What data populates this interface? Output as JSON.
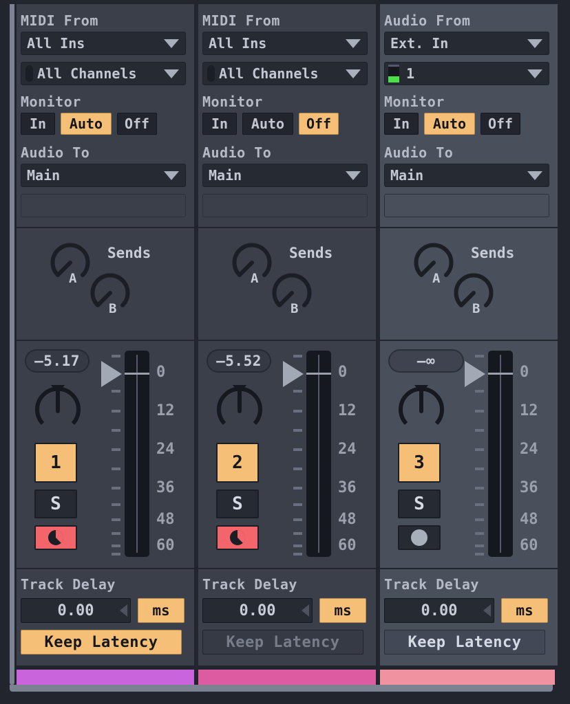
{
  "app": "Ableton Live Mixer Track I/O Panel",
  "channels": [
    {
      "type": "midi",
      "input_label": "MIDI From",
      "input_source": "All Ins",
      "input_channel": "All Channels",
      "input_channel_icon": "midi-activity-indicator",
      "monitor_label": "Monitor",
      "monitor_options": [
        "In",
        "Auto",
        "Off"
      ],
      "monitor_selected": "Auto",
      "output_label": "Audio To",
      "output_target": "Main",
      "output_subtarget": "",
      "sends_label": "Sends",
      "sends": [
        {
          "name": "A",
          "value_deg": -150
        },
        {
          "name": "B",
          "value_deg": -150
        }
      ],
      "volume_display": "–5.17",
      "pan_value_deg": 0,
      "track_number": "1",
      "solo_label": "S",
      "arm_state": "armed",
      "arm_icon": "record-arm-icon",
      "meter_scale": [
        "0",
        "12",
        "24",
        "36",
        "48",
        "60"
      ],
      "fader_position_db": "0",
      "delay_label": "Track Delay",
      "delay_value": "0.00",
      "delay_unit": "ms",
      "keep_latency_label": "Keep Latency",
      "keep_latency_state": "on",
      "track_color": "#c964dd"
    },
    {
      "type": "midi",
      "input_label": "MIDI From",
      "input_source": "All Ins",
      "input_channel": "All Channels",
      "input_channel_icon": "midi-activity-indicator",
      "monitor_label": "Monitor",
      "monitor_options": [
        "In",
        "Auto",
        "Off"
      ],
      "monitor_selected": "Off",
      "output_label": "Audio To",
      "output_target": "Main",
      "output_subtarget": "",
      "sends_label": "Sends",
      "sends": [
        {
          "name": "A",
          "value_deg": -150
        },
        {
          "name": "B",
          "value_deg": -150
        }
      ],
      "volume_display": "–5.52",
      "pan_value_deg": 0,
      "track_number": "2",
      "solo_label": "S",
      "arm_state": "armed",
      "arm_icon": "record-arm-icon",
      "meter_scale": [
        "0",
        "12",
        "24",
        "36",
        "48",
        "60"
      ],
      "fader_position_db": "0",
      "delay_label": "Track Delay",
      "delay_value": "0.00",
      "delay_unit": "ms",
      "keep_latency_label": "Keep Latency",
      "keep_latency_state": "disabled",
      "track_color": "#dd5ba0"
    },
    {
      "type": "audio",
      "input_label": "Audio From",
      "input_source": "Ext. In",
      "input_channel": "1",
      "input_channel_icon": "audio-input-level-meter",
      "monitor_label": "Monitor",
      "monitor_options": [
        "In",
        "Auto",
        "Off"
      ],
      "monitor_selected": "Auto",
      "output_label": "Audio To",
      "output_target": "Main",
      "output_subtarget": "",
      "sends_label": "Sends",
      "sends": [
        {
          "name": "A",
          "value_deg": -150
        },
        {
          "name": "B",
          "value_deg": -150
        }
      ],
      "volume_display": "—∞",
      "pan_value_deg": 0,
      "track_number": "3",
      "solo_label": "S",
      "arm_state": "disarmed",
      "arm_icon": "record-arm-icon",
      "meter_scale": [
        "0",
        "12",
        "24",
        "36",
        "48",
        "60"
      ],
      "fader_position_db": "0",
      "delay_label": "Track Delay",
      "delay_value": "0.00",
      "delay_unit": "ms",
      "keep_latency_label": "Keep Latency",
      "keep_latency_state": "off",
      "track_color": "#f0929f"
    }
  ],
  "colors": {
    "panel_bg": "#3b3f4a",
    "panel_bg_alt": "#4a4f5c",
    "window_bg": "#22252d",
    "accent_orange": "#f5bf77",
    "arm_red": "#f2656b",
    "text_primary": "#c8ccd6",
    "text_dim": "#787d8a",
    "meter_green": "#4be04b"
  }
}
